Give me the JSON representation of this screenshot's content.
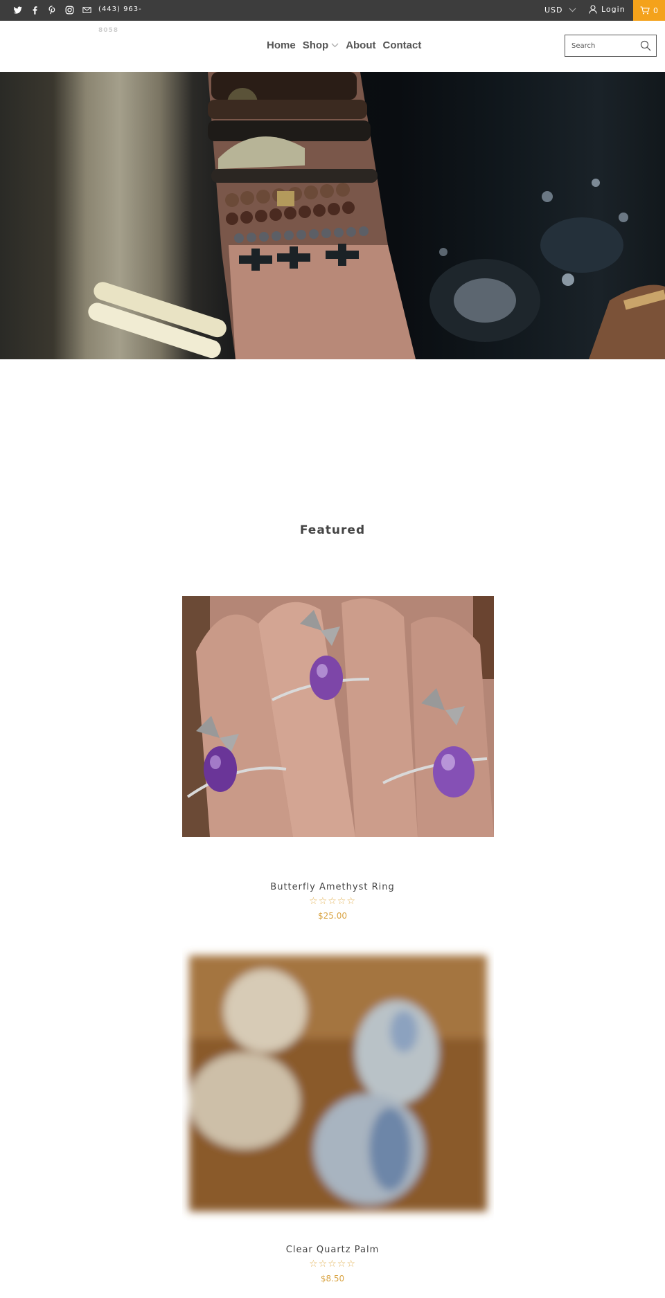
{
  "topbar": {
    "social_icons": [
      "twitter-icon",
      "facebook-icon",
      "pinterest-icon",
      "instagram-icon",
      "mail-icon"
    ],
    "phone": "(443) 963-",
    "phone_wrap": "8058",
    "currency": "USD",
    "login": "Login",
    "cart_count": "0",
    "accent_color": "#f4a21b",
    "bar_color": "#3d3d3d"
  },
  "nav": {
    "items": [
      {
        "label": "Home"
      },
      {
        "label": "Shop",
        "has_dropdown": true
      },
      {
        "label": "About"
      },
      {
        "label": "Contact"
      }
    ]
  },
  "search": {
    "placeholder": "Search"
  },
  "featured": {
    "title": "Featured",
    "products": [
      {
        "title": "Butterfly Amethyst Ring",
        "price": "$25.00",
        "stars": "☆☆☆☆☆",
        "rating": 0
      },
      {
        "title": "Clear Quartz Palm",
        "price": "$8.50",
        "stars": "☆☆☆☆☆",
        "rating": 0
      }
    ]
  }
}
